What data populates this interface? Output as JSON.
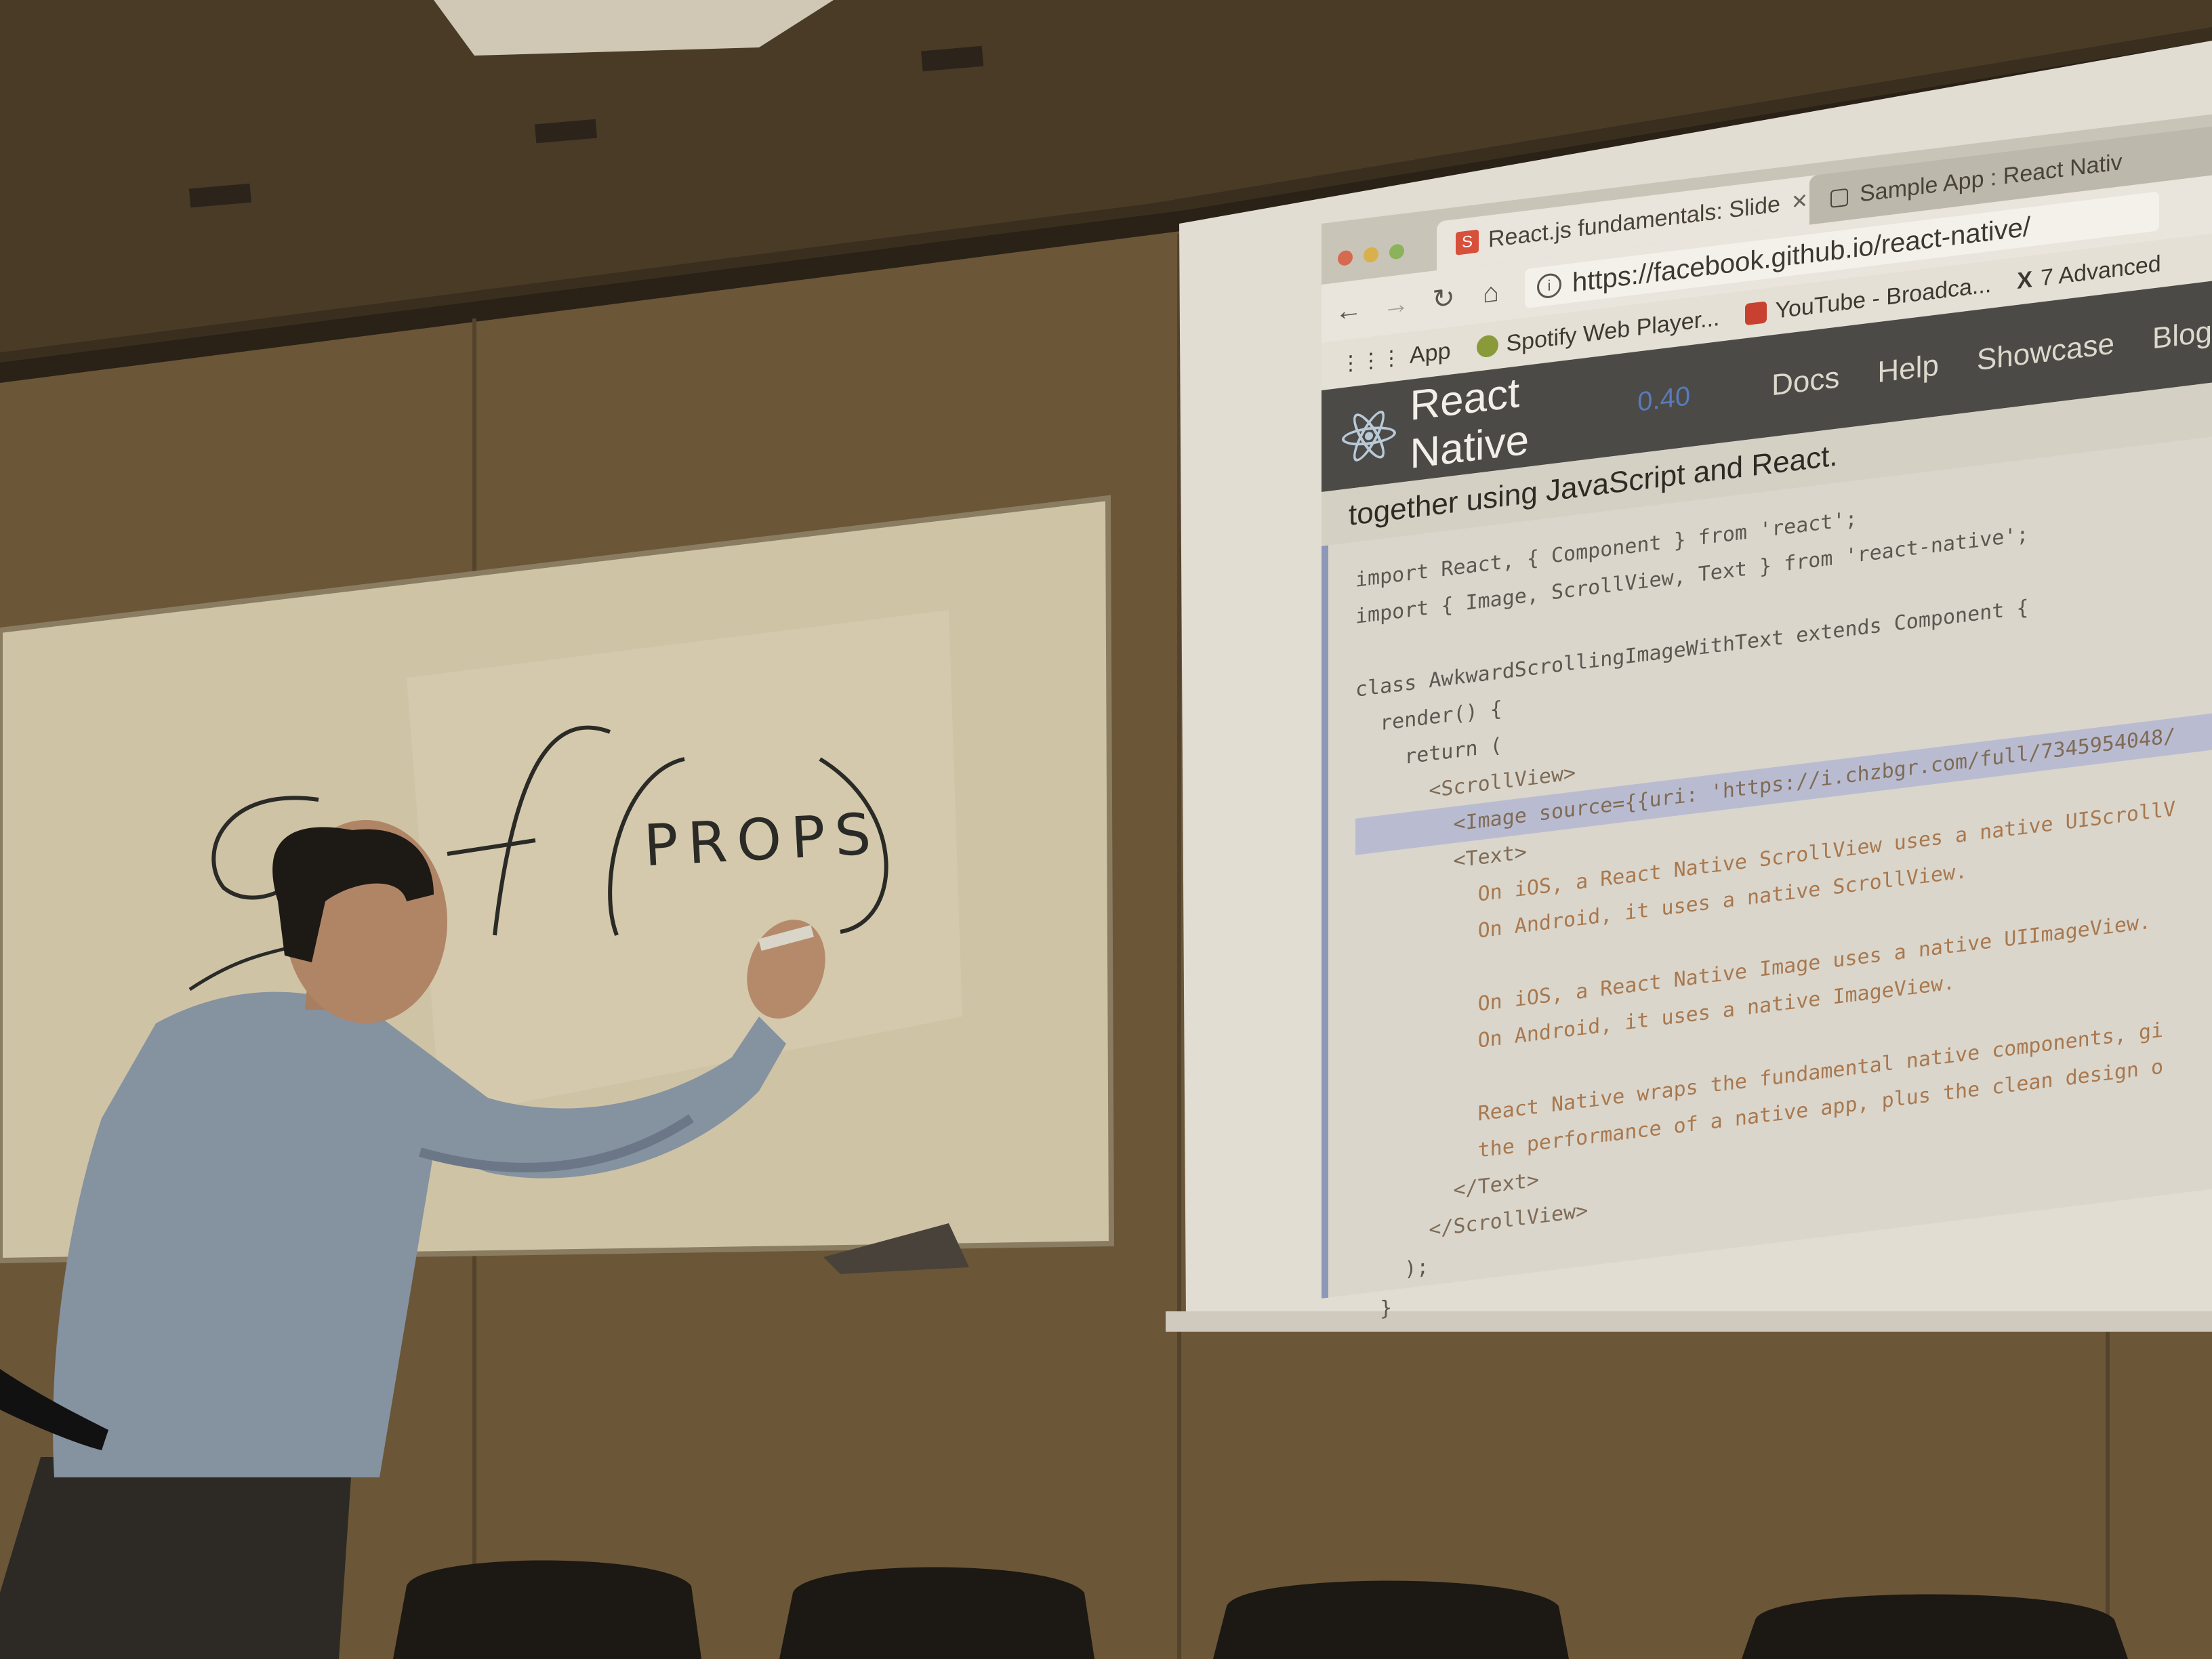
{
  "browser": {
    "tabs": [
      {
        "label": "React.js fundamentals: Slide",
        "favicon": "S",
        "active": true
      },
      {
        "label": "Sample App : React Nativ",
        "active": false
      }
    ],
    "url": "https://facebook.github.io/react-native/",
    "bookmarks": [
      "App",
      "Spotify Web Player...",
      "YouTube - Broadca...",
      "7 Advanced"
    ]
  },
  "site": {
    "brand": "React Native",
    "version": "0.40",
    "nav": [
      "Docs",
      "Help",
      "Showcase",
      "Blog"
    ],
    "subtitle": "together using JavaScript and React."
  },
  "code_lines": [
    "import React, { Component } from 'react';",
    "import { Image, ScrollView, Text } from 'react-native';",
    "",
    "class AwkwardScrollingImageWithText extends Component {",
    "  render() {",
    "    return (",
    "      <ScrollView>",
    "        <Image source={{uri: 'https://i.chzbgr.com/full/7345954048/",
    "        <Text>",
    "          On iOS, a React Native ScrollView uses a native UIScrollV",
    "          On Android, it uses a native ScrollView.",
    "",
    "          On iOS, a React Native Image uses a native UIImageView.",
    "          On Android, it uses a native ImageView.",
    "",
    "          React Native wraps the fundamental native components, gi",
    "          the performance of a native app, plus the clean design o",
    "        </Text>",
    "      </ScrollView>",
    "    );",
    "  }"
  ],
  "whiteboard": {
    "text": "PROPS"
  },
  "colors": {
    "wall": "#6b5638",
    "whiteboard": "#cfc3a6",
    "screen": "#e2ddd2",
    "rn_header": "#4b4a46"
  }
}
